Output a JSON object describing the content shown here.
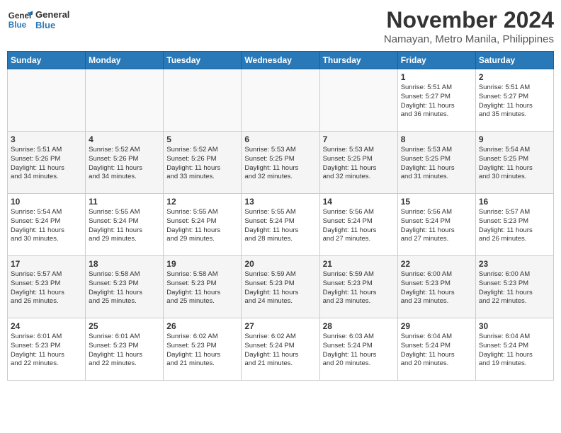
{
  "header": {
    "logo_line1": "General",
    "logo_line2": "Blue",
    "month": "November 2024",
    "location": "Namayan, Metro Manila, Philippines"
  },
  "days_of_week": [
    "Sunday",
    "Monday",
    "Tuesday",
    "Wednesday",
    "Thursday",
    "Friday",
    "Saturday"
  ],
  "weeks": [
    [
      {
        "day": "",
        "info": ""
      },
      {
        "day": "",
        "info": ""
      },
      {
        "day": "",
        "info": ""
      },
      {
        "day": "",
        "info": ""
      },
      {
        "day": "",
        "info": ""
      },
      {
        "day": "1",
        "info": "Sunrise: 5:51 AM\nSunset: 5:27 PM\nDaylight: 11 hours\nand 36 minutes."
      },
      {
        "day": "2",
        "info": "Sunrise: 5:51 AM\nSunset: 5:27 PM\nDaylight: 11 hours\nand 35 minutes."
      }
    ],
    [
      {
        "day": "3",
        "info": "Sunrise: 5:51 AM\nSunset: 5:26 PM\nDaylight: 11 hours\nand 34 minutes."
      },
      {
        "day": "4",
        "info": "Sunrise: 5:52 AM\nSunset: 5:26 PM\nDaylight: 11 hours\nand 34 minutes."
      },
      {
        "day": "5",
        "info": "Sunrise: 5:52 AM\nSunset: 5:26 PM\nDaylight: 11 hours\nand 33 minutes."
      },
      {
        "day": "6",
        "info": "Sunrise: 5:53 AM\nSunset: 5:25 PM\nDaylight: 11 hours\nand 32 minutes."
      },
      {
        "day": "7",
        "info": "Sunrise: 5:53 AM\nSunset: 5:25 PM\nDaylight: 11 hours\nand 32 minutes."
      },
      {
        "day": "8",
        "info": "Sunrise: 5:53 AM\nSunset: 5:25 PM\nDaylight: 11 hours\nand 31 minutes."
      },
      {
        "day": "9",
        "info": "Sunrise: 5:54 AM\nSunset: 5:25 PM\nDaylight: 11 hours\nand 30 minutes."
      }
    ],
    [
      {
        "day": "10",
        "info": "Sunrise: 5:54 AM\nSunset: 5:24 PM\nDaylight: 11 hours\nand 30 minutes."
      },
      {
        "day": "11",
        "info": "Sunrise: 5:55 AM\nSunset: 5:24 PM\nDaylight: 11 hours\nand 29 minutes."
      },
      {
        "day": "12",
        "info": "Sunrise: 5:55 AM\nSunset: 5:24 PM\nDaylight: 11 hours\nand 29 minutes."
      },
      {
        "day": "13",
        "info": "Sunrise: 5:55 AM\nSunset: 5:24 PM\nDaylight: 11 hours\nand 28 minutes."
      },
      {
        "day": "14",
        "info": "Sunrise: 5:56 AM\nSunset: 5:24 PM\nDaylight: 11 hours\nand 27 minutes."
      },
      {
        "day": "15",
        "info": "Sunrise: 5:56 AM\nSunset: 5:24 PM\nDaylight: 11 hours\nand 27 minutes."
      },
      {
        "day": "16",
        "info": "Sunrise: 5:57 AM\nSunset: 5:23 PM\nDaylight: 11 hours\nand 26 minutes."
      }
    ],
    [
      {
        "day": "17",
        "info": "Sunrise: 5:57 AM\nSunset: 5:23 PM\nDaylight: 11 hours\nand 26 minutes."
      },
      {
        "day": "18",
        "info": "Sunrise: 5:58 AM\nSunset: 5:23 PM\nDaylight: 11 hours\nand 25 minutes."
      },
      {
        "day": "19",
        "info": "Sunrise: 5:58 AM\nSunset: 5:23 PM\nDaylight: 11 hours\nand 25 minutes."
      },
      {
        "day": "20",
        "info": "Sunrise: 5:59 AM\nSunset: 5:23 PM\nDaylight: 11 hours\nand 24 minutes."
      },
      {
        "day": "21",
        "info": "Sunrise: 5:59 AM\nSunset: 5:23 PM\nDaylight: 11 hours\nand 23 minutes."
      },
      {
        "day": "22",
        "info": "Sunrise: 6:00 AM\nSunset: 5:23 PM\nDaylight: 11 hours\nand 23 minutes."
      },
      {
        "day": "23",
        "info": "Sunrise: 6:00 AM\nSunset: 5:23 PM\nDaylight: 11 hours\nand 22 minutes."
      }
    ],
    [
      {
        "day": "24",
        "info": "Sunrise: 6:01 AM\nSunset: 5:23 PM\nDaylight: 11 hours\nand 22 minutes."
      },
      {
        "day": "25",
        "info": "Sunrise: 6:01 AM\nSunset: 5:23 PM\nDaylight: 11 hours\nand 22 minutes."
      },
      {
        "day": "26",
        "info": "Sunrise: 6:02 AM\nSunset: 5:23 PM\nDaylight: 11 hours\nand 21 minutes."
      },
      {
        "day": "27",
        "info": "Sunrise: 6:02 AM\nSunset: 5:24 PM\nDaylight: 11 hours\nand 21 minutes."
      },
      {
        "day": "28",
        "info": "Sunrise: 6:03 AM\nSunset: 5:24 PM\nDaylight: 11 hours\nand 20 minutes."
      },
      {
        "day": "29",
        "info": "Sunrise: 6:04 AM\nSunset: 5:24 PM\nDaylight: 11 hours\nand 20 minutes."
      },
      {
        "day": "30",
        "info": "Sunrise: 6:04 AM\nSunset: 5:24 PM\nDaylight: 11 hours\nand 19 minutes."
      }
    ]
  ]
}
